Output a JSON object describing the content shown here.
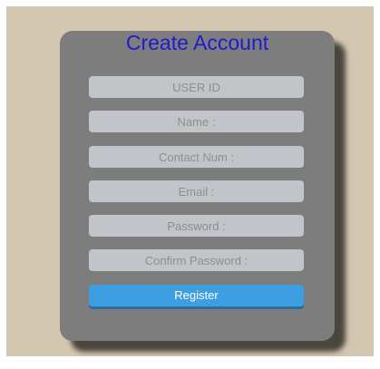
{
  "form": {
    "title": "Create Account",
    "fields": [
      {
        "placeholder": "USER ID",
        "value": ""
      },
      {
        "placeholder": "Name :",
        "value": ""
      },
      {
        "placeholder": "Contact Num :",
        "value": ""
      },
      {
        "placeholder": "Email :",
        "value": ""
      },
      {
        "placeholder": "Password :",
        "value": ""
      },
      {
        "placeholder": "Confirm Password :",
        "value": ""
      }
    ],
    "submit_label": "Register"
  },
  "colors": {
    "background": "#d4c7b0",
    "card": "#7d7d7d",
    "title": "#1f1bd0",
    "input": "#c1c5ca",
    "button": "#3d9fe2"
  }
}
